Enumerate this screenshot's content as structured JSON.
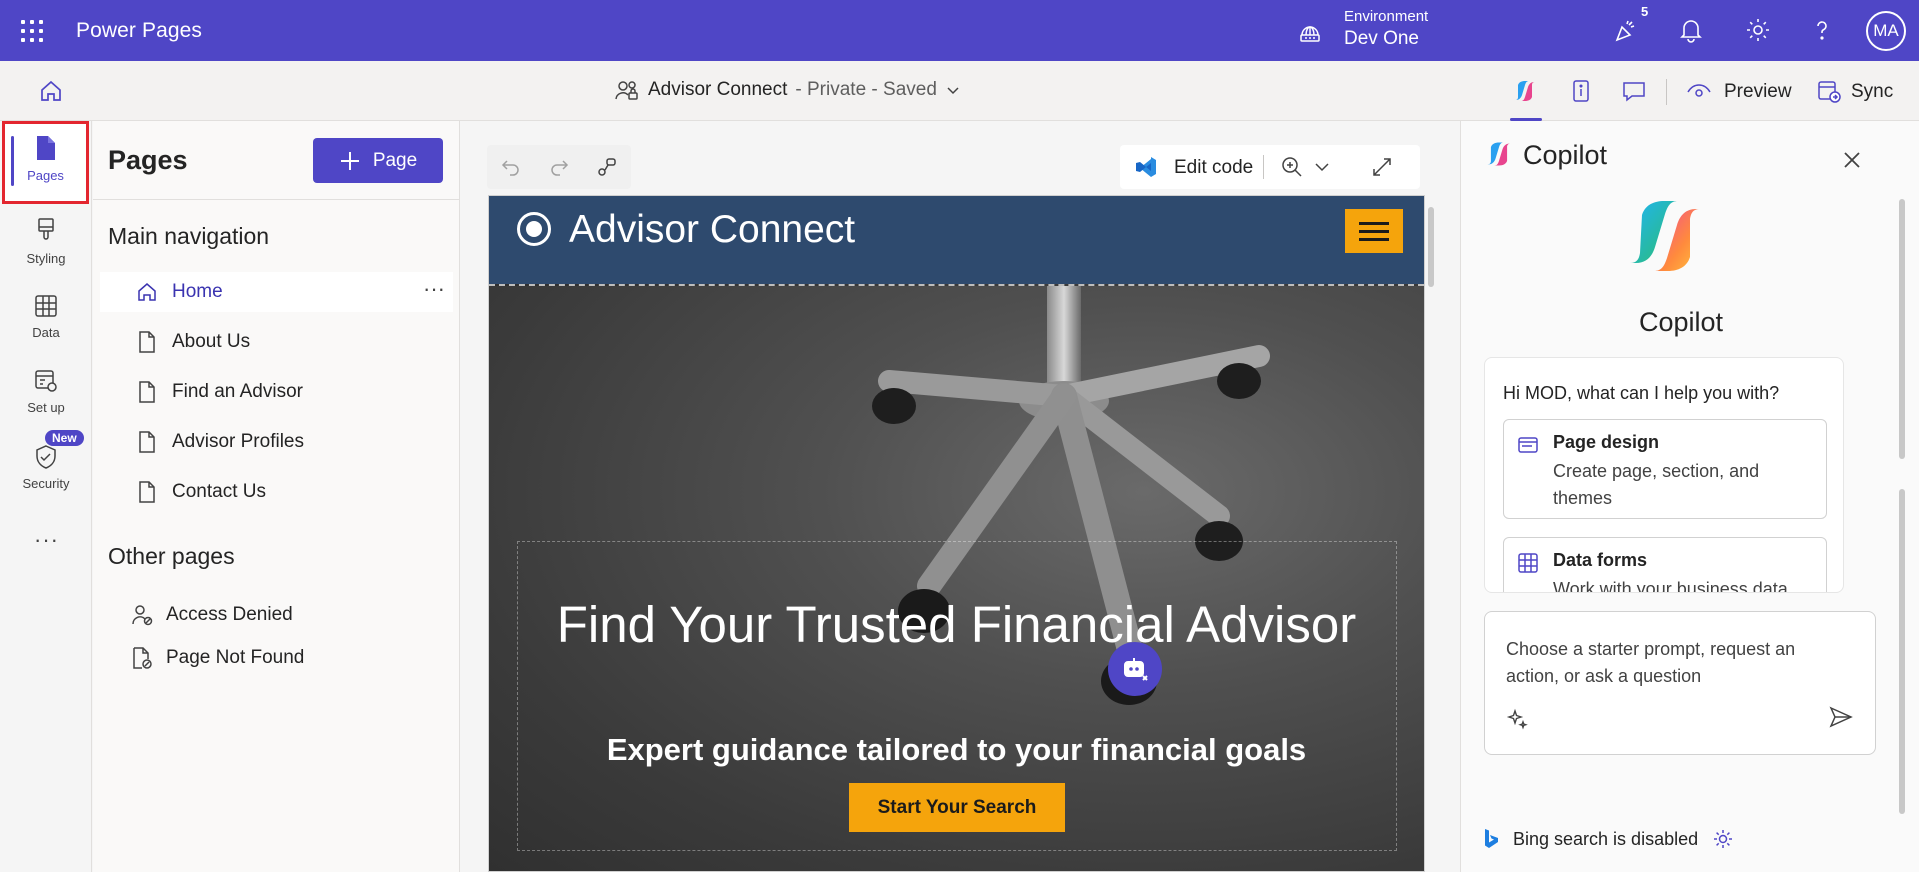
{
  "app": {
    "brand": "Power Pages",
    "environment_label": "Environment",
    "environment_value": "Dev One",
    "notification_count": "5",
    "avatar_initials": "MA",
    "accent_color": "#4f46c6"
  },
  "subbar": {
    "site_name": "Advisor Connect",
    "site_status": "- Private - Saved",
    "preview_label": "Preview",
    "sync_label": "Sync"
  },
  "rail": {
    "items": [
      {
        "label": "Pages",
        "icon": "page-icon"
      },
      {
        "label": "Styling",
        "icon": "brush-icon"
      },
      {
        "label": "Data",
        "icon": "table-icon"
      },
      {
        "label": "Set up",
        "icon": "setup-icon"
      },
      {
        "label": "Security",
        "icon": "shield-icon"
      }
    ],
    "new_badge": "New",
    "more": "···"
  },
  "pages_panel": {
    "title": "Pages",
    "add_button": "Page",
    "main_nav_heading": "Main navigation",
    "main_nav": [
      "Home",
      "About Us",
      "Find an Advisor",
      "Advisor Profiles",
      "Contact Us"
    ],
    "other_heading": "Other pages",
    "other_pages": [
      "Access Denied",
      "Page Not Found"
    ]
  },
  "canvas": {
    "edit_code_label": "Edit code",
    "site": {
      "header_title": "Advisor Connect",
      "hero_title": "Find Your Trusted Financial Advisor",
      "hero_subtitle": "Expert guidance tailored to your financial goals",
      "hero_button": "Start Your Search",
      "header_color": "#2e4a6e",
      "button_color": "#f5a40c"
    }
  },
  "copilot": {
    "title": "Copilot",
    "name": "Copilot",
    "greeting": "Hi MOD, what can I help you with?",
    "options": [
      {
        "title": "Page design",
        "desc": "Create page, section, and themes"
      },
      {
        "title": "Data forms",
        "desc": "Work with your business data"
      }
    ],
    "input_placeholder": "Choose a starter prompt, request an action, or ask a question",
    "bing_status": "Bing search is disabled"
  }
}
